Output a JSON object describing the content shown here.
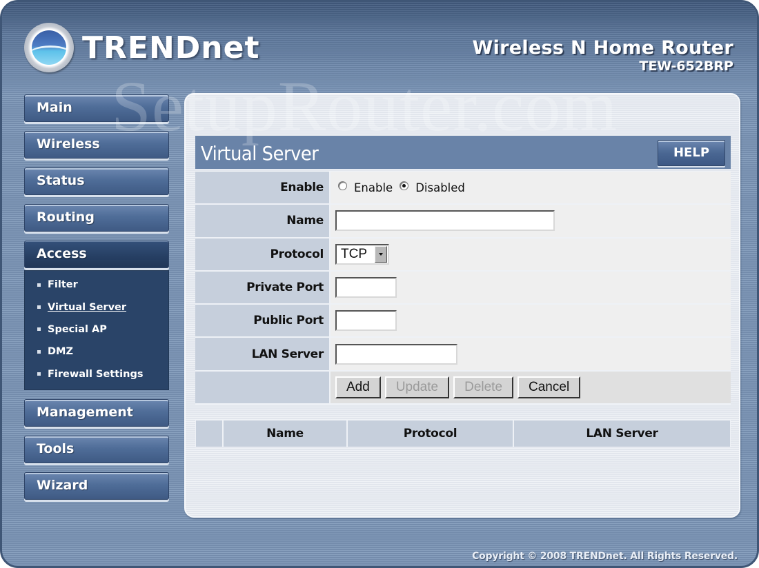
{
  "header": {
    "brand": "TRENDnet",
    "product_name": "Wireless N Home Router",
    "model": "TEW-652BRP"
  },
  "watermark": "SetupRouter.com",
  "sidebar": {
    "items": [
      {
        "label": "Main"
      },
      {
        "label": "Wireless"
      },
      {
        "label": "Status"
      },
      {
        "label": "Routing"
      },
      {
        "label": "Access",
        "active": true
      },
      {
        "label": "Management"
      },
      {
        "label": "Tools"
      },
      {
        "label": "Wizard"
      }
    ],
    "access_submenu": [
      {
        "label": "Filter"
      },
      {
        "label": "Virtual Server",
        "current": true
      },
      {
        "label": "Special AP"
      },
      {
        "label": "DMZ"
      },
      {
        "label": "Firewall Settings"
      }
    ]
  },
  "page": {
    "title": "Virtual Server",
    "help_label": "HELP"
  },
  "form": {
    "enable": {
      "label": "Enable",
      "options": [
        {
          "label": "Enable",
          "checked": false
        },
        {
          "label": "Disabled",
          "checked": true
        }
      ]
    },
    "name": {
      "label": "Name",
      "value": ""
    },
    "protocol": {
      "label": "Protocol",
      "value": "TCP"
    },
    "private_port": {
      "label": "Private Port",
      "value": ""
    },
    "public_port": {
      "label": "Public Port",
      "value": ""
    },
    "lan_server": {
      "label": "LAN Server",
      "value": ""
    },
    "buttons": {
      "add": "Add",
      "update": "Update",
      "delete": "Delete",
      "cancel": "Cancel"
    }
  },
  "list": {
    "columns": [
      "Name",
      "Protocol",
      "LAN Server"
    ],
    "rows": []
  },
  "footer": {
    "copyright": "Copyright © 2008 TRENDnet. All Rights Reserved."
  }
}
